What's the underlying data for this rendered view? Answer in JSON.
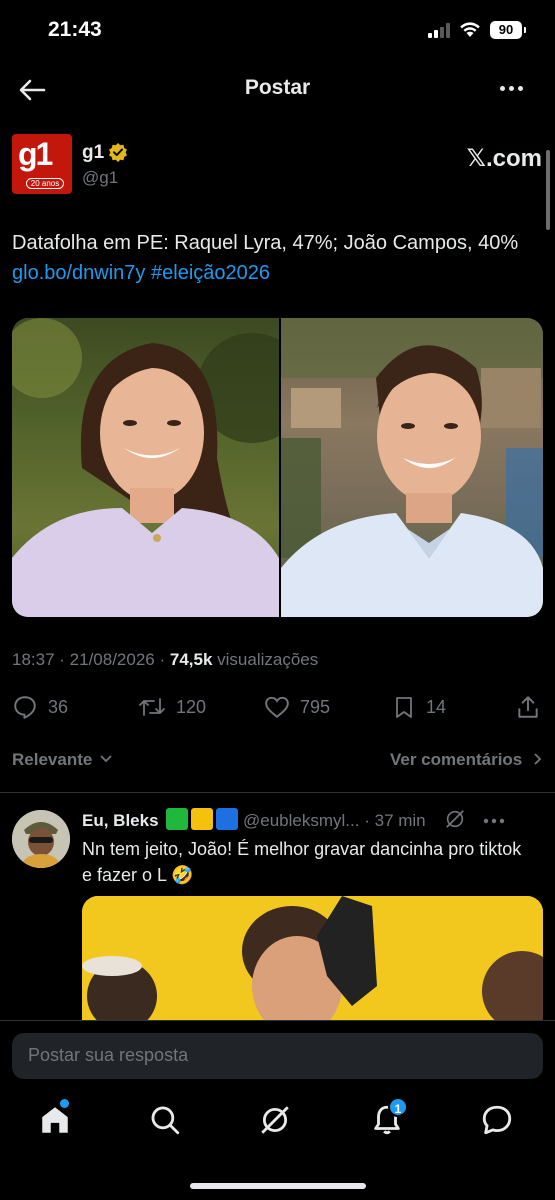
{
  "status_bar": {
    "time": "21:43",
    "battery": "90"
  },
  "header": {
    "title": "Postar"
  },
  "author": {
    "name": "g1",
    "handle": "@g1",
    "logo_text": "g1",
    "logo_sub": "20 anos",
    "source": "𝕏.com"
  },
  "tweet": {
    "text": "Datafolha em PE: Raquel Lyra, 47%; João Campos, 40% ",
    "link": "glo.bo/dnwin7y",
    "hashtag": "#eleição2026"
  },
  "meta": {
    "time": "18:37",
    "date": "21/08/2026",
    "views": "74,5k",
    "views_label": "visualizações"
  },
  "actions": {
    "replies": "36",
    "retweets": "120",
    "likes": "795",
    "bookmarks": "14"
  },
  "replies_bar": {
    "sort": "Relevante",
    "view_comments": "Ver comentários"
  },
  "reply": {
    "name": "Eu, Bleks",
    "handle": "@eubleksmyl...",
    "time": "37 min",
    "text": "Nn tem jeito, João! É melhor gravar dancinha pro tiktok e fazer o L 🤣"
  },
  "compose": {
    "placeholder": "Postar sua resposta"
  },
  "tabbar": {
    "notifications_count": "1"
  },
  "colors": {
    "accent": "#1d9bf0",
    "background": "#000000",
    "muted": "#71767b",
    "brand_g1": "#c4170c"
  }
}
